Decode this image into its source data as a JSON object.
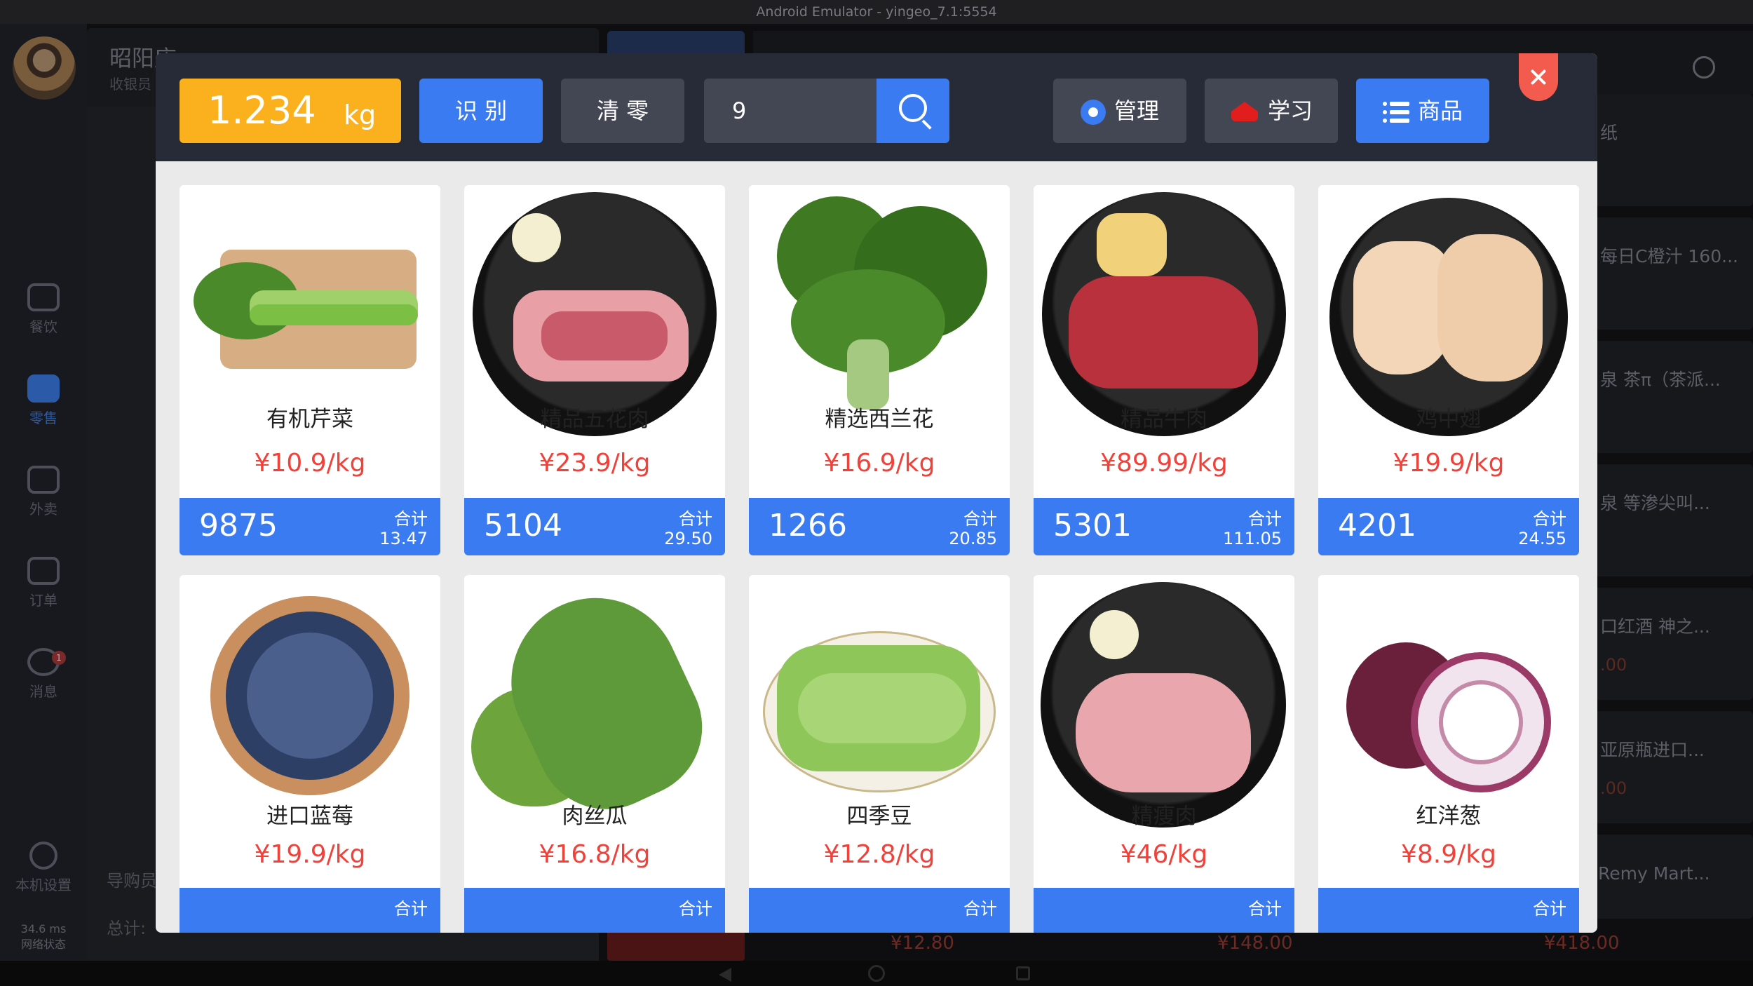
{
  "emulator": {
    "title": "Android Emulator - yingeo_7.1:5554"
  },
  "sidebar": {
    "items": [
      {
        "label": "餐饮",
        "icon": "bell-icon"
      },
      {
        "label": "零售",
        "icon": "home-icon"
      },
      {
        "label": "外卖",
        "icon": "scooter-icon"
      },
      {
        "label": "订单",
        "icon": "order-icon"
      },
      {
        "label": "消息",
        "icon": "message-icon"
      },
      {
        "label": "本机设置",
        "icon": "settings-icon"
      }
    ],
    "message_badge": "1",
    "latency": "34.6 ms",
    "network_label": "网络状态"
  },
  "store": {
    "name": "昭阳店",
    "role": "收银员"
  },
  "background": {
    "guide_label": "导购员",
    "total_label": "总计:",
    "right_items": [
      {
        "title": "纸",
        "price": ""
      },
      {
        "title": "每日C橙汁 160...",
        "price": ""
      },
      {
        "title": "泉 茶π（茶派...",
        "price": ""
      },
      {
        "title": "泉 等渗尖叫...",
        "price": ""
      },
      {
        "title": "口红酒 神之...",
        "price": ".00"
      },
      {
        "title": "亚原瓶进口...",
        "price": ".00"
      },
      {
        "title": "（Remy Mart...",
        "price": ""
      }
    ],
    "bottom_prices": [
      "¥12.80",
      "¥148.00",
      "¥418.00"
    ]
  },
  "header": {
    "weight_value": "1.234",
    "weight_unit": "kg",
    "recognize_label": "识 别",
    "clear_label": "清 零",
    "search_value": "9",
    "manage_label": "管理",
    "learn_label": "学习",
    "goods_label": "商品"
  },
  "products": [
    {
      "name": "有机芹菜",
      "price": "¥10.9/kg",
      "code": "9875",
      "sum_label": "合计",
      "sum": "13.47"
    },
    {
      "name": "精品五花肉",
      "price": "¥23.9/kg",
      "code": "5104",
      "sum_label": "合计",
      "sum": "29.50"
    },
    {
      "name": "精选西兰花",
      "price": "¥16.9/kg",
      "code": "1266",
      "sum_label": "合计",
      "sum": "20.85"
    },
    {
      "name": "精品牛肉",
      "price": "¥89.99/kg",
      "code": "5301",
      "sum_label": "合计",
      "sum": "111.05"
    },
    {
      "name": "鸡中翅",
      "price": "¥19.9/kg",
      "code": "4201",
      "sum_label": "合计",
      "sum": "24.55"
    },
    {
      "name": "进口蓝莓",
      "price": "¥19.9/kg",
      "code": "",
      "sum_label": "合计",
      "sum": ""
    },
    {
      "name": "肉丝瓜",
      "price": "¥16.8/kg",
      "code": "",
      "sum_label": "合计",
      "sum": ""
    },
    {
      "name": "四季豆",
      "price": "¥12.8/kg",
      "code": "",
      "sum_label": "合计",
      "sum": ""
    },
    {
      "name": "精瘦肉",
      "price": "¥46/kg",
      "code": "",
      "sum_label": "合计",
      "sum": ""
    },
    {
      "name": "红洋葱",
      "price": "¥8.9/kg",
      "code": "",
      "sum_label": "合计",
      "sum": ""
    }
  ],
  "colors": {
    "accent": "#3b7bf2",
    "weight": "#fbb11e",
    "price": "#f0413a",
    "close": "#f25b4d",
    "header": "#272b38"
  }
}
